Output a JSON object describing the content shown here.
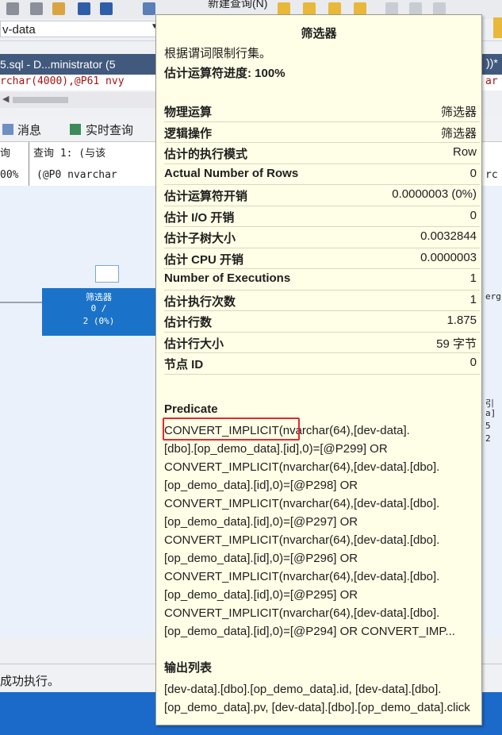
{
  "toolbar": {
    "new_query_label": "新建查询(N)"
  },
  "db_selector": {
    "value": "v-data"
  },
  "document_tab": {
    "label": "5.sql - D...ministrator (5",
    "right_fragment": "))*"
  },
  "code": {
    "line": "rchar(4000),@P61 nvy",
    "right_fragment": "ar"
  },
  "results_tabs": {
    "messages": "消息",
    "live_query": "实时查询"
  },
  "query_header": {
    "line1_left": "询",
    "line1": "查询 1: (与该",
    "line2_left": "00%",
    "line2": "(@P0 nvarchar",
    "line2_right": "rc"
  },
  "plan_node": {
    "label": "筛选器",
    "rows": "0 /",
    "estimate": "2 (0%)"
  },
  "plan_right_fragments": [
    "erg",
    "引",
    "a]",
    "5",
    "2"
  ],
  "status": {
    "message": "成功执行。"
  },
  "tooltip": {
    "title": "筛选器",
    "description": "根据谓词限制行集。",
    "progress": "估计运算符进度: 100%",
    "properties": [
      {
        "name": "物理运算",
        "value": "筛选器"
      },
      {
        "name": "逻辑操作",
        "value": "筛选器"
      },
      {
        "name": "估计的执行模式",
        "value": "Row"
      },
      {
        "name": "Actual Number of Rows",
        "value": "0"
      },
      {
        "name": "估计运算符开销",
        "value": "0.0000003 (0%)"
      },
      {
        "name": "估计 I/O 开销",
        "value": "0"
      },
      {
        "name": "估计子树大小",
        "value": "0.0032844"
      },
      {
        "name": "估计 CPU 开销",
        "value": "0.0000003"
      },
      {
        "name": "Number of Executions",
        "value": "1"
      },
      {
        "name": "估计执行次数",
        "value": "1"
      },
      {
        "name": "估计行数",
        "value": "1.875"
      },
      {
        "name": "估计行大小",
        "value": "59 字节"
      },
      {
        "name": "节点 ID",
        "value": "0"
      }
    ],
    "predicate_header": "Predicate",
    "predicate_highlight": "CONVERT_IMPLICIT",
    "predicate_first_rest": "(nvarchar(64),[dev-data].",
    "predicate_body": "[dbo].[op_demo_data].[id],0)=[@P299] OR CONVERT_IMPLICIT(nvarchar(64),[dev-data].[dbo].[op_demo_data].[id],0)=[@P298] OR CONVERT_IMPLICIT(nvarchar(64),[dev-data].[dbo].[op_demo_data].[id],0)=[@P297] OR CONVERT_IMPLICIT(nvarchar(64),[dev-data].[dbo].[op_demo_data].[id],0)=[@P296] OR CONVERT_IMPLICIT(nvarchar(64),[dev-data].[dbo].[op_demo_data].[id],0)=[@P295] OR CONVERT_IMPLICIT(nvarchar(64),[dev-data].[dbo].[op_demo_data].[id],0)=[@P294] OR CONVERT_IMP...",
    "output_header": "输出列表",
    "output_list": "[dev-data].[dbo].[op_demo_data].id, [dev-data].[dbo].[op_demo_data].pv, [dev-data].[dbo].[op_demo_data].click"
  },
  "colors": {
    "tooltip_bg": "#fffee6",
    "highlight_border": "#e22b2b",
    "plan_node": "#1a73c9",
    "status_bar": "#1b6ac9",
    "doc_tab": "#41597c"
  }
}
